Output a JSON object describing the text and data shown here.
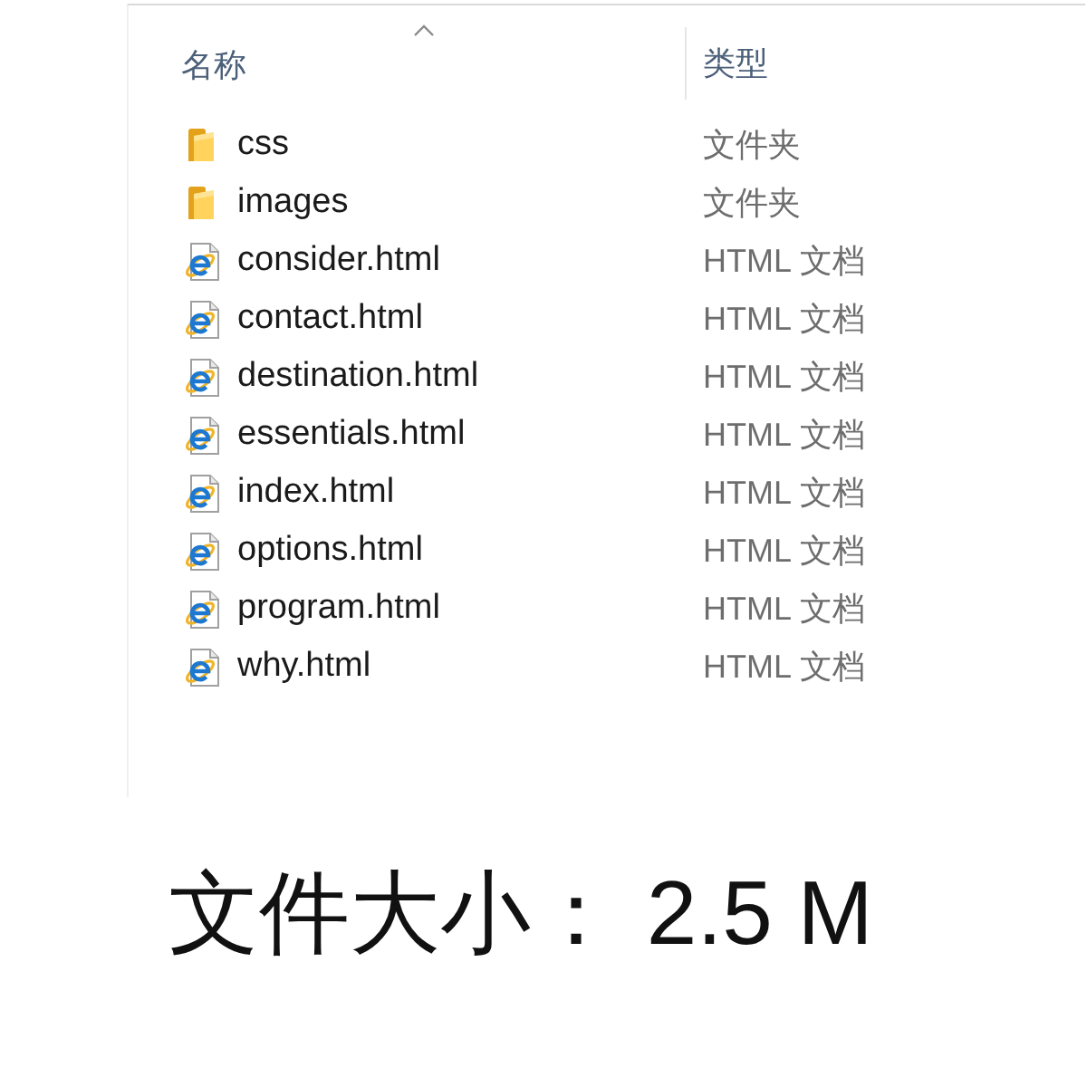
{
  "file_list": {
    "columns": [
      {
        "label": "名称",
        "sorted": true
      },
      {
        "label": "类型",
        "sorted": false
      }
    ],
    "rows": [
      {
        "kind": "folder",
        "name": "css",
        "type": "文件夹"
      },
      {
        "kind": "folder",
        "name": "images",
        "type": "文件夹"
      },
      {
        "kind": "html",
        "name": "consider.html",
        "type": "HTML 文档"
      },
      {
        "kind": "html",
        "name": "contact.html",
        "type": "HTML 文档"
      },
      {
        "kind": "html",
        "name": "destination.html",
        "type": "HTML 文档"
      },
      {
        "kind": "html",
        "name": "essentials.html",
        "type": "HTML 文档"
      },
      {
        "kind": "html",
        "name": "index.html",
        "type": "HTML 文档"
      },
      {
        "kind": "html",
        "name": "options.html",
        "type": "HTML 文档"
      },
      {
        "kind": "html",
        "name": "program.html",
        "type": "HTML 文档"
      },
      {
        "kind": "html",
        "name": "why.html",
        "type": "HTML 文档"
      }
    ]
  },
  "caption": "文件大小： 2.5 M"
}
